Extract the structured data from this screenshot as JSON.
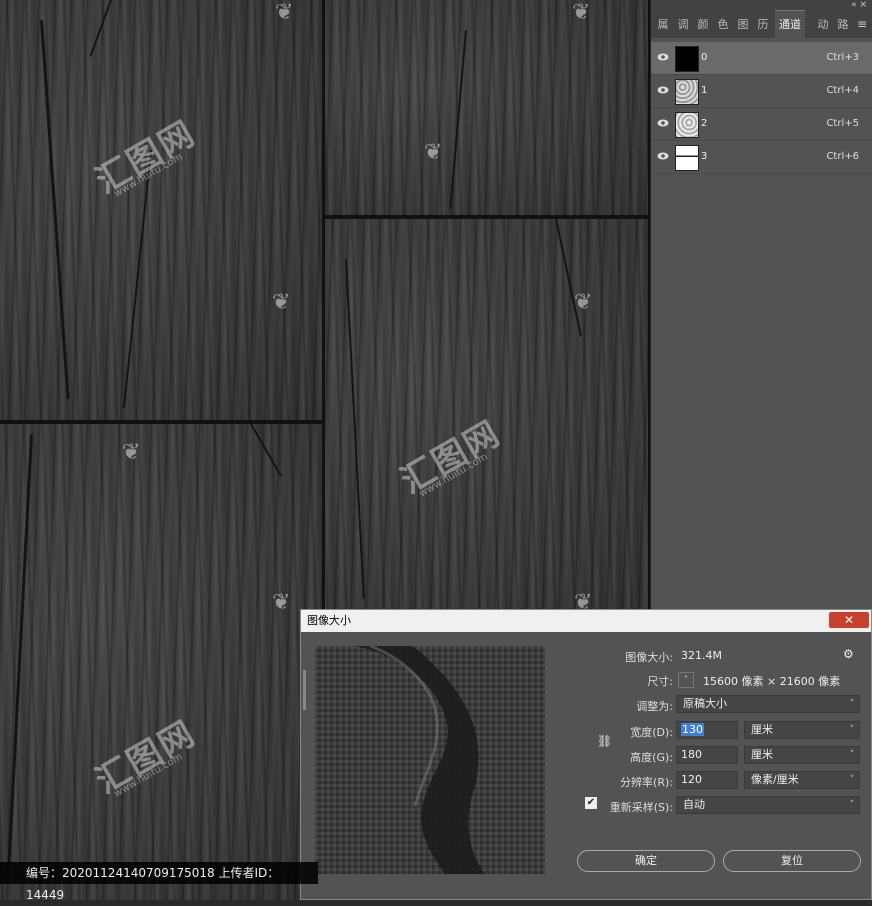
{
  "panel": {
    "tabs": [
      "属",
      "调",
      "颜",
      "色",
      "图",
      "历",
      "通道",
      "动",
      "路"
    ],
    "active_tab": "通道",
    "menu_icon": "hamburger-icon",
    "window_controls": "« ×",
    "channels": [
      {
        "name": "0",
        "shortcut": "Ctrl+3",
        "selected": true,
        "thumb": "#000000"
      },
      {
        "name": "1",
        "shortcut": "Ctrl+4",
        "selected": false,
        "thumb": "#cfcfcf"
      },
      {
        "name": "2",
        "shortcut": "Ctrl+5",
        "selected": false,
        "thumb": "#dcdcdc"
      },
      {
        "name": "3",
        "shortcut": "Ctrl+6",
        "selected": false,
        "thumb": "#f4f4f4"
      }
    ]
  },
  "dialog": {
    "title": "图像大小",
    "close": "✕",
    "image_size_label": "图像大小:",
    "image_size_value": "321.4M",
    "dimensions_label": "尺寸:",
    "dimensions_value": "15600 像素 × 21600 像素",
    "fit_to_label": "调整为:",
    "fit_to_value": "原稿大小",
    "width_label": "宽度(D):",
    "width_value": "130",
    "width_unit": "厘米",
    "height_label": "高度(G):",
    "height_value": "180",
    "height_unit": "厘米",
    "resolution_label": "分辨率(R):",
    "resolution_value": "120",
    "resolution_unit": "像素/厘米",
    "resample_label": "重新采样(S):",
    "resample_checked": true,
    "resample_value": "自动",
    "ok_label": "确定",
    "reset_label": "复位"
  },
  "watermark": {
    "brand": "汇图网",
    "url": "www.huitu.com"
  },
  "footer": {
    "text": "编号：20201124140709175018 上传者ID： 14449"
  }
}
